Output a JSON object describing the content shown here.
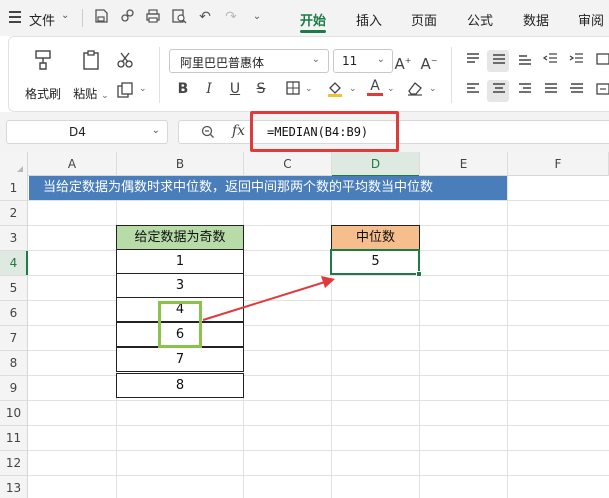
{
  "menubar": {
    "file_label": "文件",
    "tabs": [
      {
        "label": "开始",
        "active": true
      },
      {
        "label": "插入",
        "active": false
      },
      {
        "label": "页面",
        "active": false
      },
      {
        "label": "公式",
        "active": false
      },
      {
        "label": "数据",
        "active": false
      },
      {
        "label": "审阅",
        "active": false
      }
    ]
  },
  "ribbon": {
    "format_painter": "格式刷",
    "paste": "粘贴",
    "font_name": "阿里巴巴普惠体",
    "font_size": "11"
  },
  "formula_bar": {
    "name_box": "D4",
    "fx": "fx",
    "formula": "=MEDIAN(B4:B9)"
  },
  "sheet": {
    "columns": [
      "A",
      "B",
      "C",
      "D",
      "E",
      "F"
    ],
    "rows": [
      "1",
      "2",
      "3",
      "4",
      "5",
      "6",
      "7",
      "8",
      "9",
      "10",
      "11",
      "12",
      "13"
    ],
    "banner": "当给定数据为偶数时求中位数，返回中间那两个数的平均数当中位数",
    "data_header": "给定数据为奇数",
    "data_values": [
      "1",
      "3",
      "4",
      "6",
      "7",
      "8"
    ],
    "median_header": "中位数",
    "median_value": "5"
  },
  "colors": {
    "accent": "#1e7b45",
    "banner": "#4a7ebb",
    "data_header_fill": "#b7dca8",
    "median_header_fill": "#f6be8d",
    "highlight_box": "#8bc34a",
    "annotation_red": "#e03a3a"
  }
}
